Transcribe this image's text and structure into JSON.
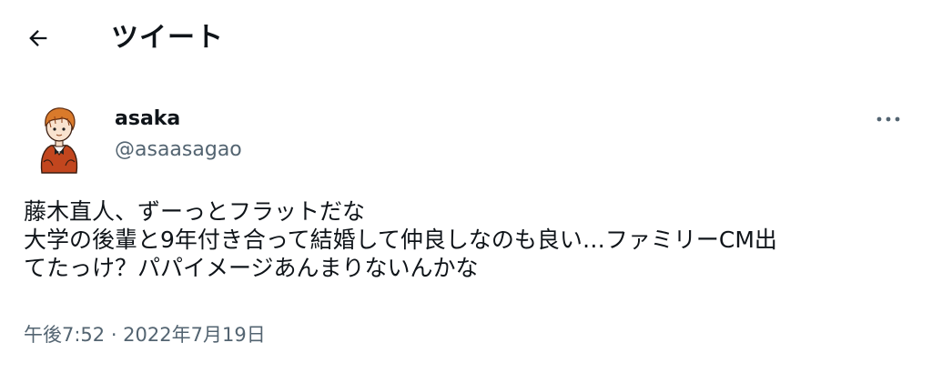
{
  "header": {
    "back_icon": "arrow-left-icon",
    "title": "ツイート"
  },
  "tweet": {
    "author": {
      "display_name": "asaka",
      "handle": "@asaasagao",
      "avatar": "illustrated-avatar"
    },
    "more_icon": "more-horizontal-icon",
    "text_lines": [
      "藤木直人、ずーっとフラットだな",
      "大学の後輩と9年付き合って結婚して仲良しなのも良い…ファミリーCM出",
      "てたっけ？パパイメージあんまりないんかな"
    ],
    "timestamp": "午後7:52 · 2022年7月19日"
  },
  "colors": {
    "text": "#0f1419",
    "secondary": "#536471"
  }
}
